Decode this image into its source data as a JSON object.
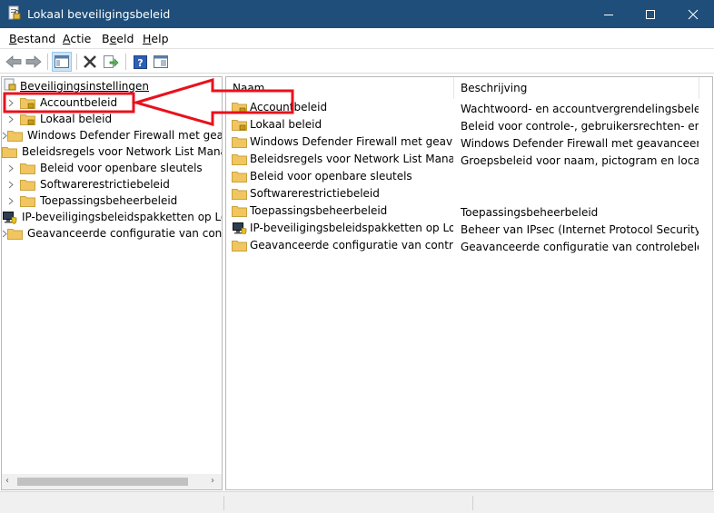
{
  "window": {
    "title": "Lokaal beveiligingsbeleid",
    "icon": "security-policy-icon"
  },
  "menu": {
    "items": [
      {
        "label": "Bestand",
        "accel": "B"
      },
      {
        "label": "Actie",
        "accel": "A"
      },
      {
        "label": "Beeld",
        "accel": "e"
      },
      {
        "label": "Help",
        "accel": "H"
      }
    ]
  },
  "toolbar": {
    "icons": [
      "back-arrow-icon",
      "forward-arrow-icon",
      "show-hide-tree-icon",
      "delete-icon",
      "export-list-icon",
      "help-icon",
      "properties-icon"
    ]
  },
  "tree": {
    "root": "Beveiligingsinstellingen",
    "items": [
      {
        "label": "Accountbeleid",
        "icon": "folder-lock-icon"
      },
      {
        "label": "Lokaal beleid",
        "icon": "folder-lock-icon"
      },
      {
        "label": "Windows Defender Firewall met geavanceerde beveiliging",
        "icon": "folder-icon"
      },
      {
        "label": "Beleidsregels voor Network List Manager",
        "icon": "folder-icon"
      },
      {
        "label": "Beleid voor openbare sleutels",
        "icon": "folder-icon"
      },
      {
        "label": "Softwarerestrictiebeleid",
        "icon": "folder-icon"
      },
      {
        "label": "Toepassingsbeheerbeleid",
        "icon": "folder-icon"
      },
      {
        "label": "IP-beveiligingsbeleidspakketten op Lokale computer",
        "icon": "monitor-shield-icon"
      },
      {
        "label": "Geavanceerde configuratie van controlebeleid",
        "icon": "folder-icon"
      }
    ]
  },
  "list": {
    "columns": [
      "Naam",
      "Beschrijving"
    ],
    "rows": [
      {
        "name": "Accountbeleid",
        "desc": "Wachtwoord- en accountvergrendelingsbeleid",
        "icon": "folder-lock-icon"
      },
      {
        "name": "Lokaal beleid",
        "desc": "Beleid voor controle-, gebruikersrechten- en be...",
        "icon": "folder-lock-icon"
      },
      {
        "name": "Windows Defender Firewall met geavanc...",
        "desc": "Windows Defender Firewall met geavanceerde ...",
        "icon": "folder-icon"
      },
      {
        "name": "Beleidsregels voor Network List Manager",
        "desc": "Groepsbeleid voor naam, pictogram en locatie ...",
        "icon": "folder-icon"
      },
      {
        "name": "Beleid voor openbare sleutels",
        "desc": "",
        "icon": "folder-icon"
      },
      {
        "name": "Softwarerestrictiebeleid",
        "desc": "",
        "icon": "folder-icon"
      },
      {
        "name": "Toepassingsbeheerbeleid",
        "desc": "Toepassingsbeheerbeleid",
        "icon": "folder-icon"
      },
      {
        "name": "IP-beveiligingsbeleidspakketten op Lokal...",
        "desc": "Beheer van IPsec (Internet Protocol Security). H...",
        "icon": "monitor-shield-icon"
      },
      {
        "name": "Geavanceerde configuratie van controleb...",
        "desc": "Geavanceerde configuratie van controlebeleid",
        "icon": "folder-icon"
      }
    ]
  },
  "colors": {
    "titlebar": "#1e4e79",
    "folder": "#f1c660",
    "annotation": "#e8111c"
  }
}
